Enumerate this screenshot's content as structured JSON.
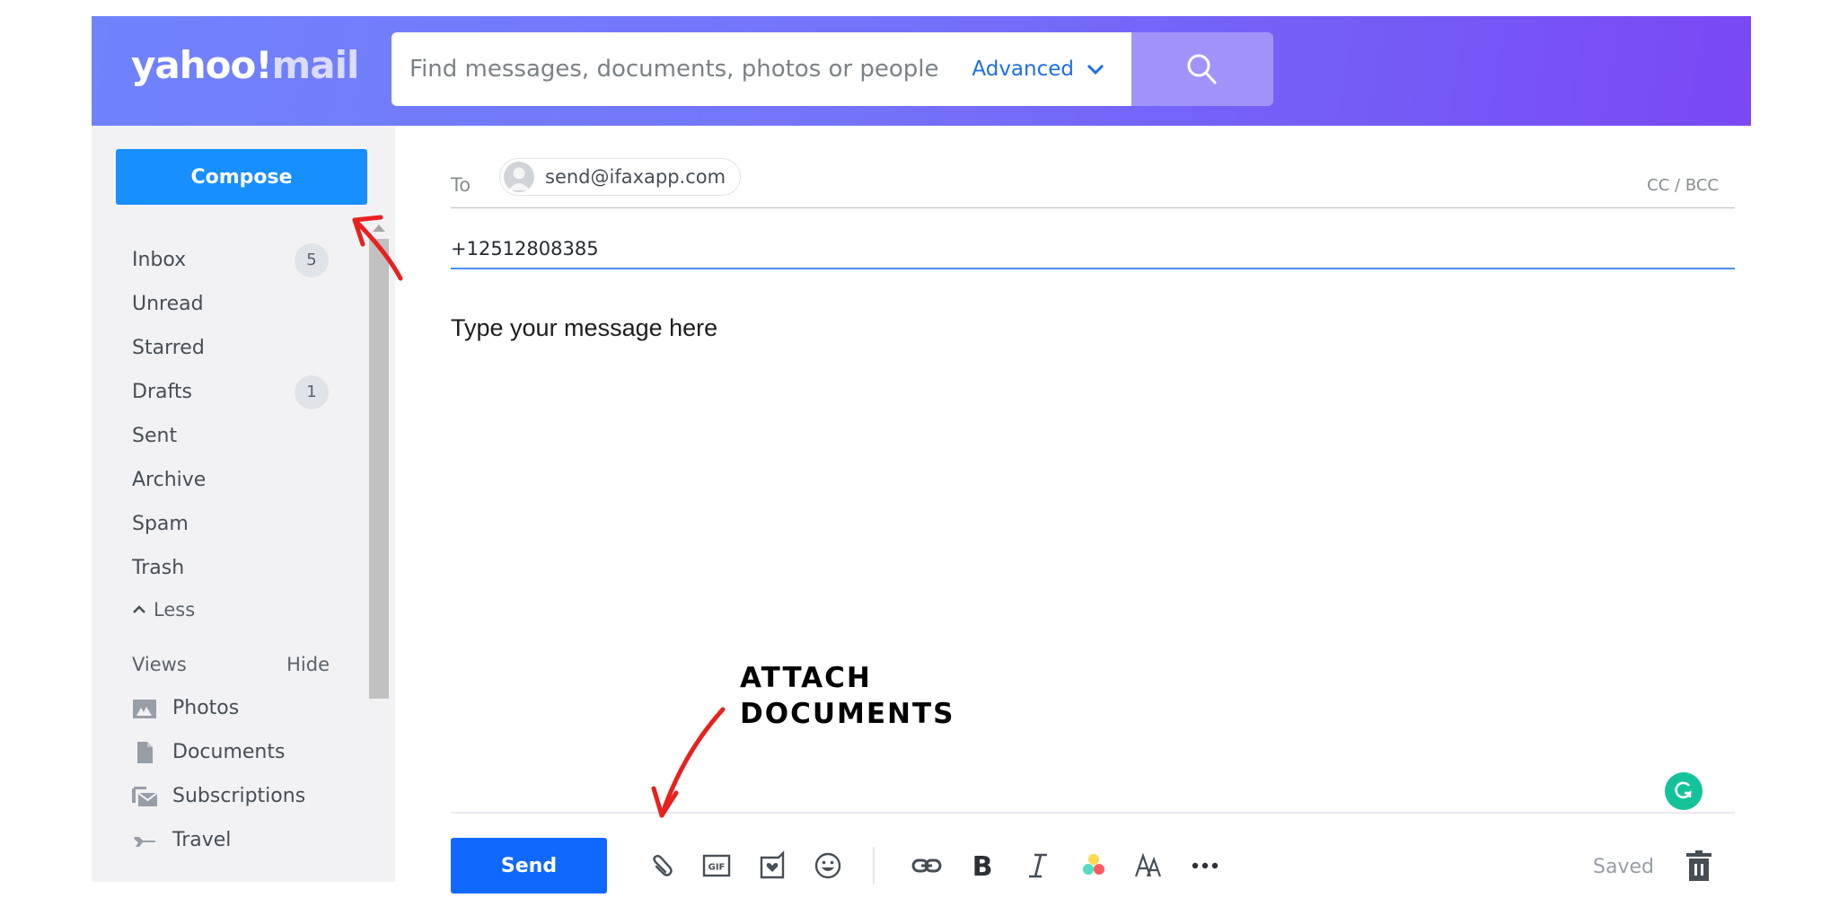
{
  "header": {
    "logo_primary": "yahoo!",
    "logo_secondary": "mail",
    "search_placeholder": "Find messages, documents, photos or people",
    "advanced_label": "Advanced",
    "search_icon": "magnifier-icon"
  },
  "sidebar": {
    "compose_label": "Compose",
    "folders": [
      {
        "label": "Inbox",
        "count": "5"
      },
      {
        "label": "Unread"
      },
      {
        "label": "Starred"
      },
      {
        "label": "Drafts",
        "count": "1"
      },
      {
        "label": "Sent"
      },
      {
        "label": "Archive"
      },
      {
        "label": "Spam"
      },
      {
        "label": "Trash"
      }
    ],
    "less_label": "Less",
    "views_label": "Views",
    "hide_label": "Hide",
    "views": [
      {
        "label": "Photos",
        "icon": "photo-icon"
      },
      {
        "label": "Documents",
        "icon": "document-icon"
      },
      {
        "label": "Subscriptions",
        "icon": "subscriptions-icon"
      },
      {
        "label": "Travel",
        "icon": "plane-icon"
      }
    ]
  },
  "compose": {
    "to_label": "To",
    "recipient": "send@ifaxapp.com",
    "cc_bcc_label": "CC / BCC",
    "subject_value": "+12512808385",
    "body_text": "Type your message here",
    "send_label": "Send",
    "saved_label": "Saved",
    "toolbar_icons": [
      "attach-icon",
      "gif-icon",
      "stationery-icon",
      "emoji-icon",
      "link-icon",
      "bold-icon",
      "italic-icon",
      "color-icon",
      "font-size-icon",
      "more-icon"
    ]
  },
  "annotation": {
    "line1": "ATTACH",
    "line2": "DOCUMENTS",
    "color": "#e8211f"
  },
  "colors": {
    "header_start": "#7083fb",
    "header_end": "#7b48f4",
    "compose_button": "#188fff",
    "send_button": "#0f69ff",
    "accent_link": "#1b6fe8",
    "grammarly": "#15c39a"
  }
}
